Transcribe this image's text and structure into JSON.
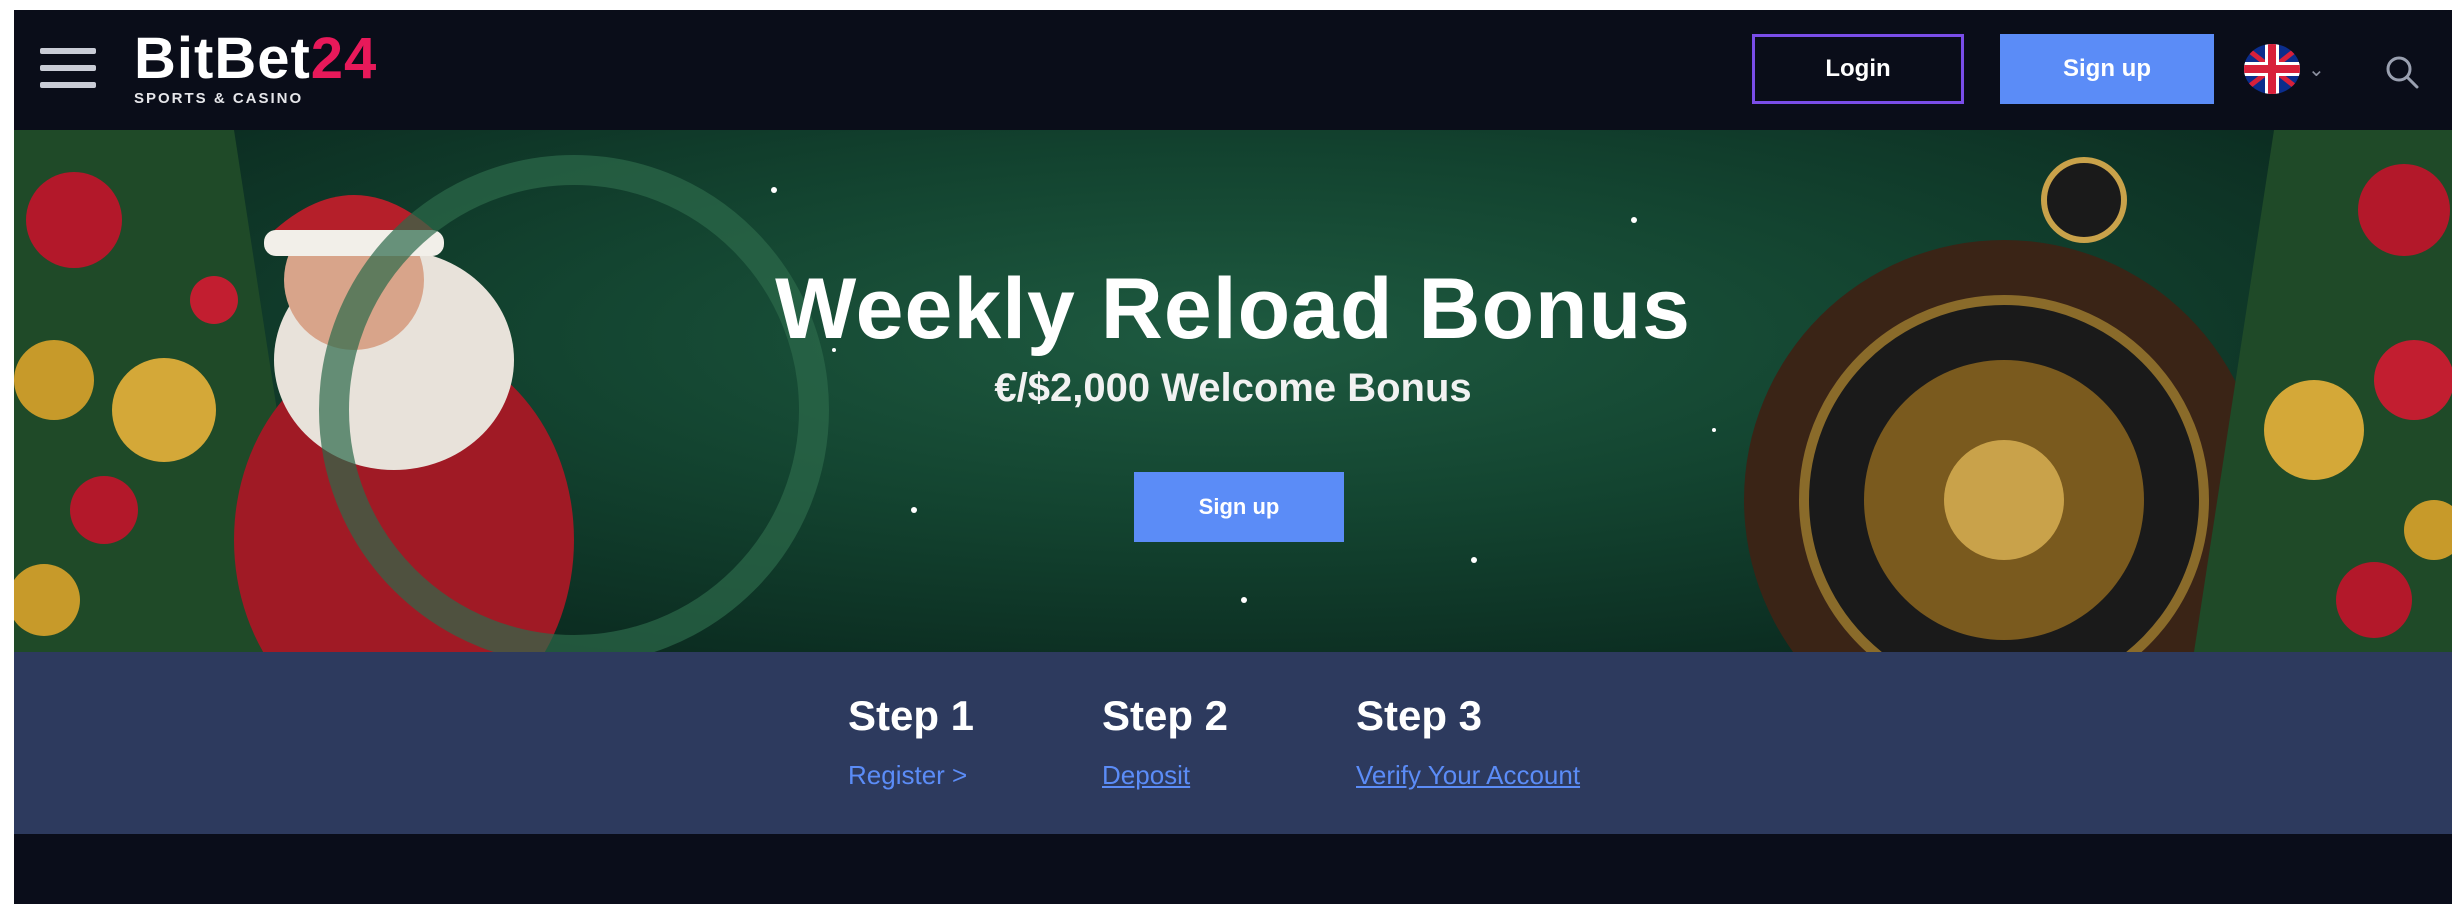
{
  "header": {
    "logo_text": "BitBet",
    "logo_number": "24",
    "logo_tagline": "SPORTS & CASINO",
    "login_label": "Login",
    "signup_label": "Sign up",
    "language_icon": "uk-flag-icon",
    "menu_icon": "hamburger-menu-icon",
    "search_icon": "search-icon"
  },
  "banner": {
    "title": "Weekly Reload Bonus",
    "subtitle": "€/$2,000 Welcome Bonus",
    "cta_label": "Sign up"
  },
  "steps": [
    {
      "title": "Step 1",
      "link": "Register >"
    },
    {
      "title": "Step 2",
      "link": "Deposit"
    },
    {
      "title": "Step 3",
      "link": "Verify Your Account"
    }
  ],
  "colors": {
    "header_bg": "#0a0d19",
    "accent_blue": "#5b8cf7",
    "login_border": "#7a4de8",
    "logo_accent": "#e8195a",
    "steps_bg": "#2d3a5e",
    "banner_green": "#134430"
  }
}
